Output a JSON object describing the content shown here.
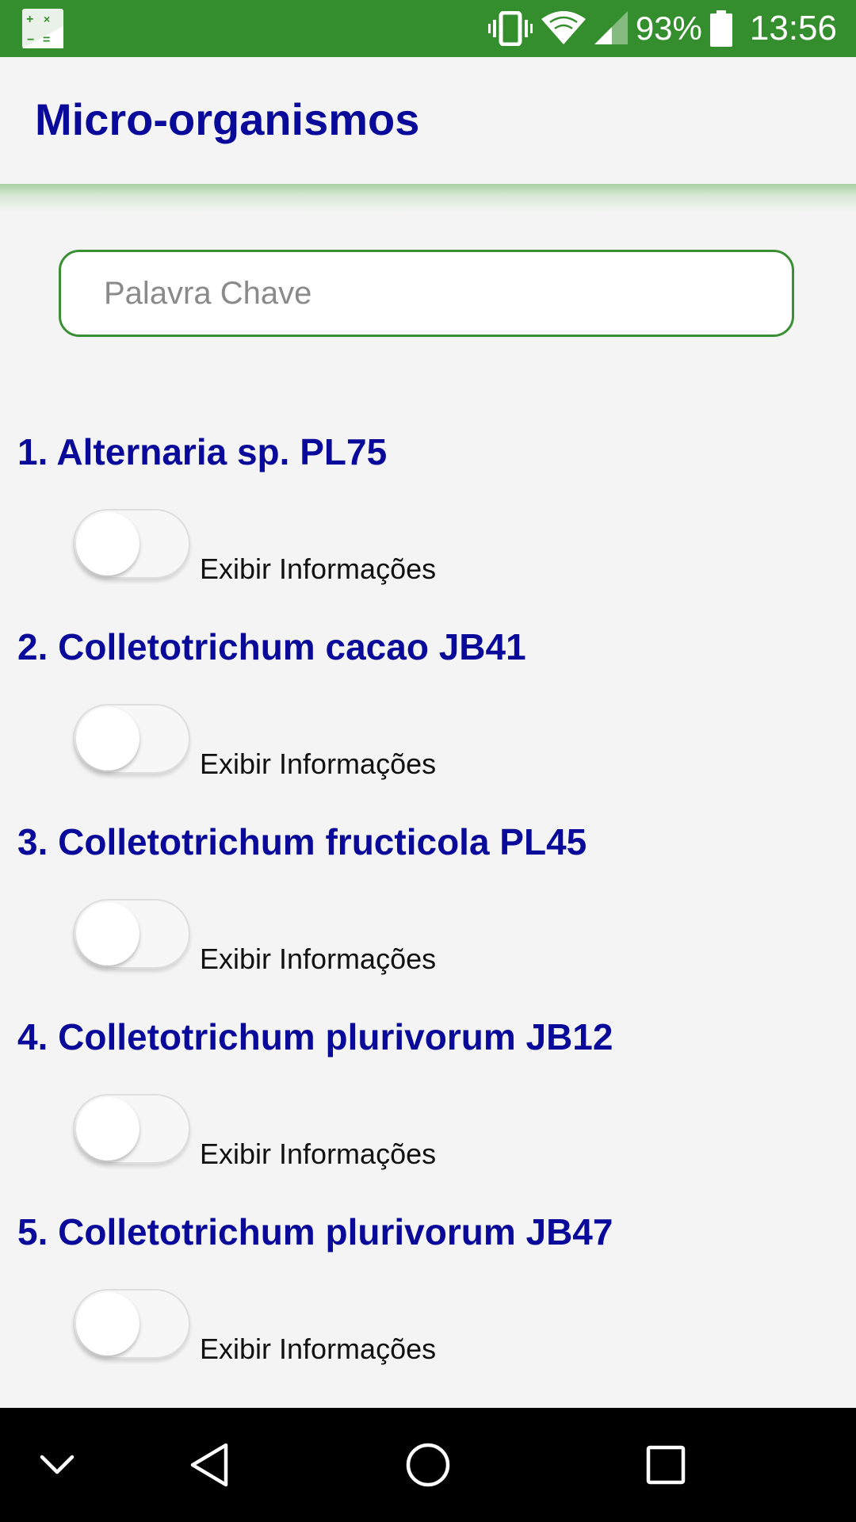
{
  "status_bar": {
    "battery_percent": "93%",
    "time": "13:56",
    "icons": [
      "calculator-app-icon",
      "vibrate-icon",
      "wifi-icon",
      "signal-icon",
      "battery-icon"
    ]
  },
  "app_bar": {
    "title": "Micro-organismos"
  },
  "search": {
    "placeholder": "Palavra Chave",
    "value": ""
  },
  "items": [
    {
      "title": "1. Alternaria sp. PL75",
      "toggle_label": "Exibir Informações",
      "toggle_on": false
    },
    {
      "title": "2. Colletotrichum cacao JB41",
      "toggle_label": "Exibir Informações",
      "toggle_on": false
    },
    {
      "title": "3. Colletotrichum fructicola PL45",
      "toggle_label": "Exibir Informações",
      "toggle_on": false
    },
    {
      "title": "4. Colletotrichum plurivorum JB12",
      "toggle_label": "Exibir Informações",
      "toggle_on": false
    },
    {
      "title": "5. Colletotrichum plurivorum JB47",
      "toggle_label": "Exibir Informações",
      "toggle_on": false
    }
  ],
  "nav_bar": {
    "icons": [
      "chevron-down-icon",
      "back-icon",
      "home-icon",
      "recents-icon"
    ]
  },
  "colors": {
    "status_bar": "#358e2e",
    "title_blue": "#0a0a9a",
    "search_border": "#3a8f35",
    "background": "#f4f4f4"
  }
}
